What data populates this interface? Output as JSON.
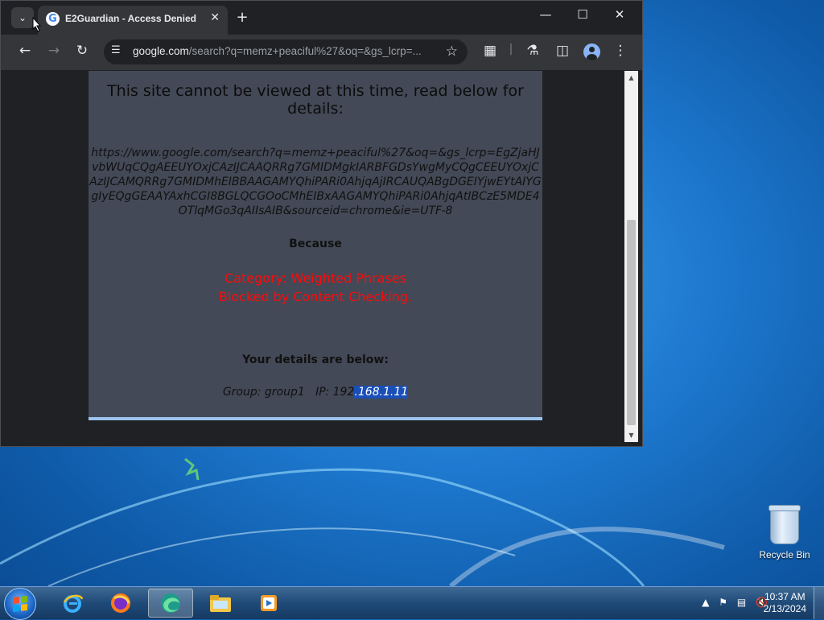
{
  "browser": {
    "tab_title": "E2Guardian - Access Denied",
    "favicon_letter": "G",
    "new_tab": "+",
    "url_host": "google.com",
    "url_path": "/search?q=memz+peaciful%27&oq=&gs_lcrp=..."
  },
  "page": {
    "heading": "This site cannot be viewed at this time, read below for details:",
    "blocked_url": "https://www.google.com/search?q=memz+peaciful%27&oq=&gs_lcrp=EgZjaHJvbWUqCQgAEEUYOxjCAzIJCAAQRRg7GMIDMgkIARBFGDsYwgMyCQgCEEUYOxjCAzIJCAMQRRg7GMIDMhEIBBAAGAMYQhiPARi0AhjqAjIRCAUQABgDGEIYjwEYtAIYGgIyEQgGEAAYAxhCGI8BGLQCGOoCMhEIBxAAGAMYQhiPARi0AhjqAtIBCzE5MDE4OTlqMGo3qAIIsAIB&sourceid=chrome&ie=UTF-8",
    "because": "Because",
    "category": "Category: Weighted Phrases",
    "blocked_by": "Blocked by Content Checking.",
    "details_heading": "Your details are below:",
    "group_label": "Group: group1",
    "ip_label": "IP: 192",
    "ip_selected": ".168.1.11"
  },
  "desktop": {
    "recycle_bin": "Recycle Bin"
  },
  "taskbar": {
    "time": "10:37 AM",
    "date": "2/13/2024"
  },
  "colors": {
    "reason_red": "#ff0a0a",
    "panel_bg": "#434956",
    "selection": "#1a4fb8"
  }
}
